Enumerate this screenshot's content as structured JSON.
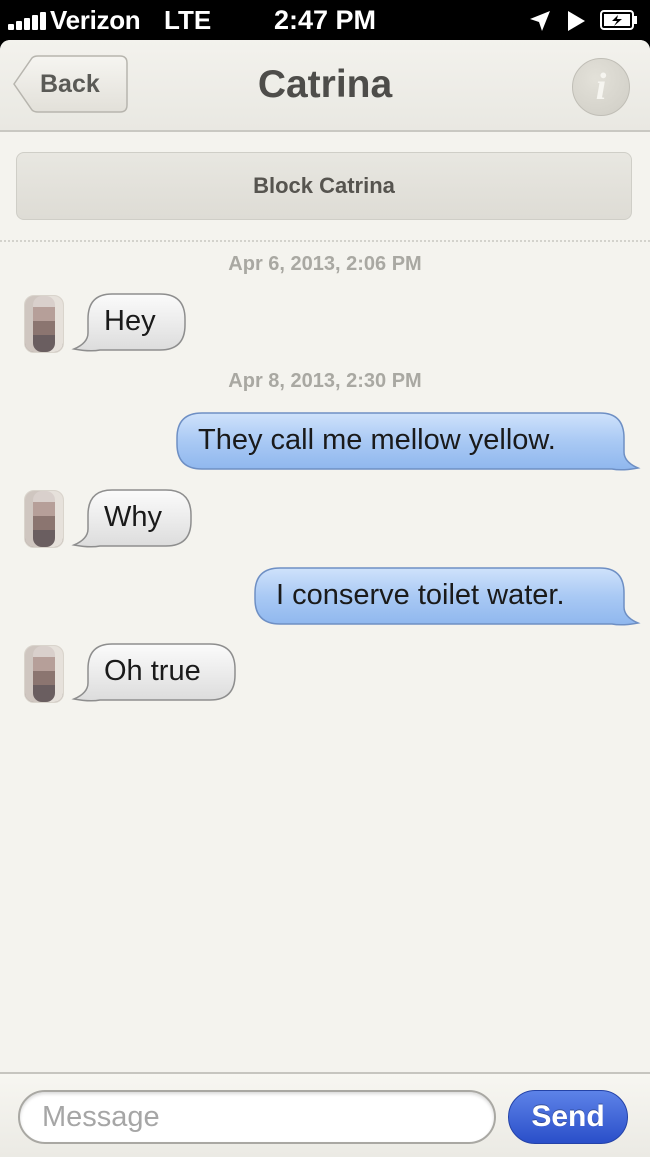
{
  "status_bar": {
    "carrier": "Verizon",
    "network": "LTE",
    "time": "2:47 PM",
    "icons": [
      "signal-bars-icon",
      "location-arrow-icon",
      "play-icon",
      "battery-charging-icon"
    ]
  },
  "nav": {
    "back_label": "Back",
    "title": "Catrina",
    "info_glyph": "i"
  },
  "block_label": "Block Catrina",
  "timestamps": [
    "Apr 6, 2013, 2:06 PM",
    "Apr 8, 2013, 2:30 PM"
  ],
  "messages": [
    {
      "from": "them",
      "text": "Hey"
    },
    {
      "from": "me",
      "text": "They call me mellow yellow."
    },
    {
      "from": "them",
      "text": "Why"
    },
    {
      "from": "me",
      "text": "I conserve toilet water."
    },
    {
      "from": "them",
      "text": "Oh true"
    }
  ],
  "composer": {
    "placeholder": "Message",
    "send_label": "Send"
  },
  "colors": {
    "incoming_bubble": "#eeeeee",
    "outgoing_bubble": "#a8c8f5",
    "send_button": "#2f55d0"
  }
}
